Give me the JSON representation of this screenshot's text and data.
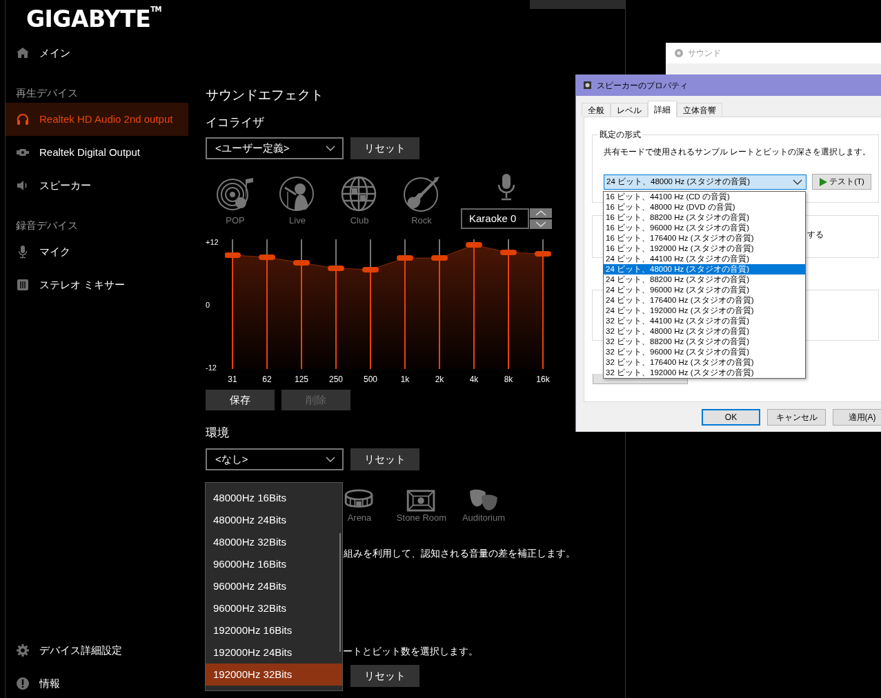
{
  "app": {
    "brand": "GIGABYTE$^{TM}$",
    "sidebar": [
      {
        "kind": "item",
        "label": "メイン",
        "selected": false
      },
      {
        "kind": "heading",
        "label": "再生デバイス"
      },
      {
        "kind": "item",
        "label": "Realtek HD Audio 2nd output",
        "selected": true
      },
      {
        "kind": "item",
        "label": "Realtek Digital Output",
        "selected": false
      },
      {
        "kind": "item",
        "label": "スピーカー",
        "selected": false
      },
      {
        "kind": "heading",
        "label": "録音デバイス"
      },
      {
        "kind": "item",
        "label": "マイク",
        "selected": false
      },
      {
        "kind": "item",
        "label": "ステレオ ミキサー",
        "selected": false
      },
      {
        "kind": "footer_item",
        "label": "デバイス詳細設定",
        "selected": false
      },
      {
        "kind": "footer_item",
        "label": "情報",
        "selected": false
      }
    ],
    "sound_effects": {
      "title": "サウンドエフェクト",
      "equalizer": {
        "label": "イコライザ",
        "preset": "<ユーザー定義>",
        "reset": "リセット",
        "styles": [
          "POP",
          "Live",
          "Club",
          "Rock"
        ],
        "karaoke": "Karaoke 0",
        "scale": [
          "+12",
          "0",
          "-12"
        ],
        "bands": [
          {
            "label": "31",
            "level": 0.878
          },
          {
            "label": "62",
            "level": 0.862
          },
          {
            "label": "125",
            "level": 0.819
          },
          {
            "label": "250",
            "level": 0.777
          },
          {
            "label": "500",
            "level": 0.766
          },
          {
            "label": "1k",
            "level": 0.856
          },
          {
            "label": "2k",
            "level": 0.856
          },
          {
            "label": "4k",
            "level": 0.957
          },
          {
            "label": "8k",
            "level": 0.899
          },
          {
            "label": "16k",
            "level": 0.888
          }
        ],
        "save": "保存",
        "delete": {
          "label": "削除",
          "disabled": true
        }
      },
      "environment": {
        "label": "環境",
        "value": "<なし>",
        "reset": "リセット",
        "styles": [
          "Arena",
          "Stone Room",
          "Auditorium"
        ],
        "description": "組みを利用して、認知される音量の差を補正します。"
      },
      "format": {
        "description": "ートとビット数を選択します。",
        "reset": "リセット"
      }
    },
    "format_menu": [
      {
        "label": "48000Hz 16Bits",
        "selected": false
      },
      {
        "label": "48000Hz 24Bits",
        "selected": false
      },
      {
        "label": "48000Hz 32Bits",
        "selected": false
      },
      {
        "label": "96000Hz 16Bits",
        "selected": false
      },
      {
        "label": "96000Hz 24Bits",
        "selected": false
      },
      {
        "label": "96000Hz 32Bits",
        "selected": false
      },
      {
        "label": "192000Hz 16Bits",
        "selected": false
      },
      {
        "label": "192000Hz 24Bits",
        "selected": false
      },
      {
        "label": "192000Hz 32Bits",
        "selected": true
      }
    ]
  },
  "sound_window": {
    "title": "サウンド"
  },
  "speaker_dialog": {
    "title": "スピーカーのプロパティ",
    "tabs": [
      {
        "label": "全般",
        "selected": false
      },
      {
        "label": "レベル",
        "selected": false
      },
      {
        "label": "詳細",
        "selected": true
      },
      {
        "label": "立体音響",
        "selected": false
      }
    ],
    "default_format": {
      "legend": "既定の形式",
      "description": "共有モードで使用されるサンプル レートとビットの深さを選択します。",
      "value": "24 ビット、48000 Hz (スタジオの音質)",
      "test": "テスト(T)",
      "options": [
        {
          "label": "16 ビット、44100 Hz (CD の音質)",
          "selected": false
        },
        {
          "label": "16 ビット、48000 Hz (DVD の音質)",
          "selected": false
        },
        {
          "label": "16 ビット、88200 Hz (スタジオの音質)",
          "selected": false
        },
        {
          "label": "16 ビット、96000 Hz (スタジオの音質)",
          "selected": false
        },
        {
          "label": "16 ビット、176400 Hz (スタジオの音質)",
          "selected": false
        },
        {
          "label": "16 ビット、192000 Hz (スタジオの音質)",
          "selected": false
        },
        {
          "label": "24 ビット、44100 Hz (スタジオの音質)",
          "selected": false
        },
        {
          "label": "24 ビット、48000 Hz (スタジオの音質)",
          "selected": true
        },
        {
          "label": "24 ビット、88200 Hz (スタジオの音質)",
          "selected": false
        },
        {
          "label": "24 ビット、96000 Hz (スタジオの音質)",
          "selected": false
        },
        {
          "label": "24 ビット、176400 Hz (スタジオの音質)",
          "selected": false
        },
        {
          "label": "24 ビット、192000 Hz (スタジオの音質)",
          "selected": false
        },
        {
          "label": "32 ビット、44100 Hz (スタジオの音質)",
          "selected": false
        },
        {
          "label": "32 ビット、48000 Hz (スタジオの音質)",
          "selected": false
        },
        {
          "label": "32 ビット、88200 Hz (スタジオの音質)",
          "selected": false
        },
        {
          "label": "32 ビット、96000 Hz (スタジオの音質)",
          "selected": false
        },
        {
          "label": "32 ビット、176400 Hz (スタジオの音質)",
          "selected": false
        },
        {
          "label": "32 ビット、192000 Hz (スタジオの音質)",
          "selected": false
        }
      ]
    },
    "exclusive": {
      "text": "する"
    },
    "buttons": [
      "OK",
      "キャンセル",
      "適用(A)"
    ]
  }
}
